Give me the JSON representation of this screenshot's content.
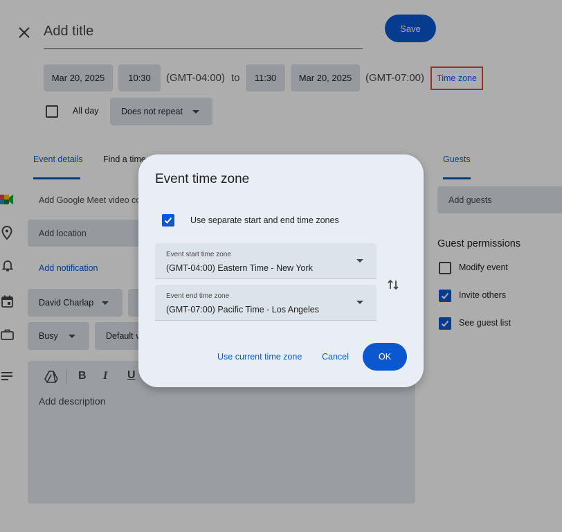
{
  "header": {
    "title_placeholder": "Add title",
    "save_label": "Save"
  },
  "datetime": {
    "start_date": "Mar 20, 2025",
    "start_time": "10:30",
    "start_tz": "(GMT-04:00)",
    "to_label": "to",
    "end_time": "11:30",
    "end_date": "Mar 20, 2025",
    "end_tz": "(GMT-07:00)",
    "timezone_link": "Time zone",
    "all_day_label": "All day",
    "repeat_value": "Does not repeat"
  },
  "tabs": {
    "event_details": "Event details",
    "find_time": "Find a time",
    "guests": "Guests"
  },
  "details": {
    "meet": "Add Google Meet video conferencing",
    "location_placeholder": "Add location",
    "notification": "Add notification",
    "calendar_owner": "David Charlap",
    "busy": "Busy",
    "visibility": "Default visibility",
    "description_placeholder": "Add description"
  },
  "guests": {
    "add_placeholder": "Add guests",
    "permissions_title": "Guest permissions",
    "permissions": [
      {
        "label": "Modify event",
        "checked": false
      },
      {
        "label": "Invite others",
        "checked": true
      },
      {
        "label": "See guest list",
        "checked": true
      }
    ]
  },
  "dialog": {
    "title": "Event time zone",
    "separate_label": "Use separate start and end time zones",
    "separate_checked": true,
    "start_label": "Event start time zone",
    "start_value": "(GMT-04:00) Eastern Time - New York",
    "end_label": "Event end time zone",
    "end_value": "(GMT-07:00) Pacific Time - Los Angeles",
    "use_current": "Use current time zone",
    "cancel": "Cancel",
    "ok": "OK"
  },
  "colors": {
    "accent": "#0b57d0",
    "highlight_border": "#e8452c",
    "chip_bg": "#dde3ea",
    "dialog_bg": "#e9eef6"
  }
}
